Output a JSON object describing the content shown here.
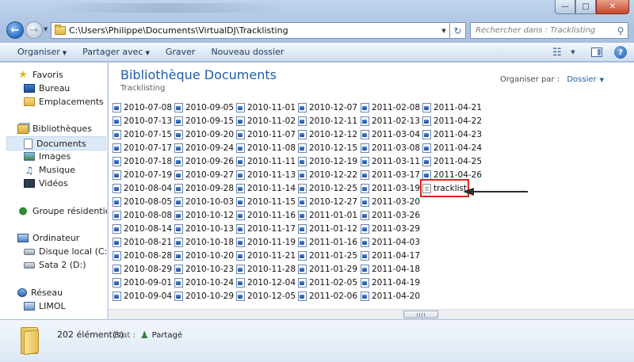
{
  "address": {
    "path": "C:\\Users\\Philippe\\Documents\\VirtualDJ\\Tracklisting"
  },
  "search": {
    "placeholder": "Rechercher dans : Tracklisting"
  },
  "toolbar": {
    "organize": "Organiser",
    "share": "Partager avec",
    "burn": "Graver",
    "new_folder": "Nouveau dossier"
  },
  "nav": {
    "favorites": "Favoris",
    "desktop": "Bureau",
    "recent_places": "Emplacements récents",
    "libraries": "Bibliothèques",
    "documents": "Documents",
    "images": "Images",
    "music": "Musique",
    "videos": "Vidéos",
    "homegroup": "Groupe résidentiel",
    "computer": "Ordinateur",
    "local_disk": "Disque local (C:)",
    "sata": "Sata 2 (D:)",
    "network": "Réseau",
    "limol": "LIMOL"
  },
  "main": {
    "title": "Bibliothèque Documents",
    "subtitle": "Tracklisting",
    "arrange_label": "Organiser par :",
    "arrange_value": "Dossier",
    "columns": [
      [
        "2010-07-08",
        "2010-07-13",
        "2010-07-15",
        "2010-07-17",
        "2010-07-18",
        "2010-07-19",
        "2010-08-04",
        "2010-08-05",
        "2010-08-08",
        "2010-08-14",
        "2010-08-21",
        "2010-08-28",
        "2010-08-29",
        "2010-09-01",
        "2010-09-04"
      ],
      [
        "2010-09-05",
        "2010-09-15",
        "2010-09-20",
        "2010-09-24",
        "2010-09-26",
        "2010-09-27",
        "2010-09-28",
        "2010-10-03",
        "2010-10-12",
        "2010-10-13",
        "2010-10-18",
        "2010-10-20",
        "2010-10-23",
        "2010-10-24",
        "2010-10-29"
      ],
      [
        "2010-11-01",
        "2010-11-02",
        "2010-11-07",
        "2010-11-08",
        "2010-11-11",
        "2010-11-13",
        "2010-11-14",
        "2010-11-15",
        "2010-11-16",
        "2010-11-17",
        "2010-11-19",
        "2010-11-21",
        "2010-11-28",
        "2010-12-04",
        "2010-12-05"
      ],
      [
        "2010-12-07",
        "2010-12-11",
        "2010-12-12",
        "2010-12-15",
        "2010-12-19",
        "2010-12-22",
        "2010-12-25",
        "2010-12-27",
        "2011-01-01",
        "2011-01-12",
        "2011-01-16",
        "2011-01-25",
        "2011-01-29",
        "2011-02-05",
        "2011-02-06"
      ],
      [
        "2011-02-08",
        "2011-02-13",
        "2011-03-04",
        "2011-03-08",
        "2011-03-11",
        "2011-03-17",
        "2011-03-19",
        "2011-03-20",
        "2011-03-26",
        "2011-03-29",
        "2011-04-03",
        "2011-04-17",
        "2011-04-18",
        "2011-04-19",
        "2011-04-20"
      ],
      [
        "2011-04-21",
        "2011-04-22",
        "2011-04-23",
        "2011-04-24",
        "2011-04-25",
        "2011-04-26",
        "tracklist"
      ]
    ]
  },
  "status": {
    "count": "202 élément(s)",
    "state_label": "État :",
    "state_value": "Partagé"
  },
  "colors": {
    "accent": "#1e5ea8",
    "highlight": "#e2231a"
  }
}
